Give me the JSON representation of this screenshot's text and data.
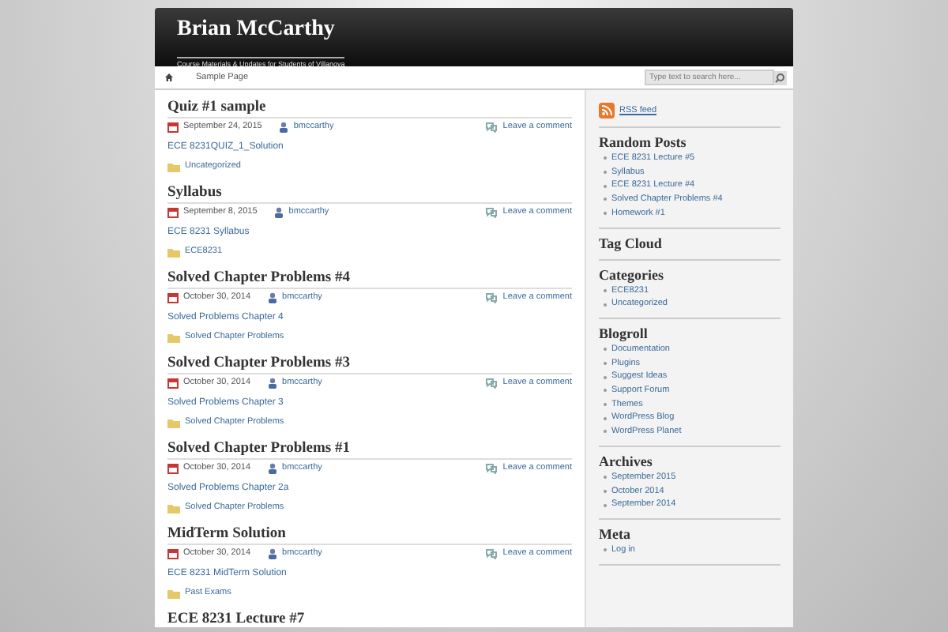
{
  "header": {
    "title": "Brian McCarthy",
    "tagline": "Course Materials & Updates for Students of Villanova"
  },
  "nav": {
    "items": [
      {
        "label": "Sample Page",
        "selected": false
      }
    ],
    "search": {
      "placeholder": "Type text to search here..."
    }
  },
  "posts": [
    {
      "title": "Quiz #1 sample",
      "date": "September 24, 2015",
      "author": "bmccarthy",
      "comments": "Leave a comment",
      "excerpt": "ECE 8231QUIZ_1_Solution",
      "category": "Uncategorized"
    },
    {
      "title": "Syllabus",
      "date": "September 8, 2015",
      "author": "bmccarthy",
      "comments": "Leave a comment",
      "excerpt": "ECE 8231 Syllabus",
      "category": "ECE8231"
    },
    {
      "title": "Solved Chapter Problems #4",
      "date": "October 30, 2014",
      "author": "bmccarthy",
      "comments": "Leave a comment",
      "excerpt": "Solved Problems Chapter 4",
      "category": "Solved Chapter Problems"
    },
    {
      "title": "Solved Chapter Problems #3",
      "date": "October 30, 2014",
      "author": "bmccarthy",
      "comments": "Leave a comment",
      "excerpt": "Solved Problems Chapter 3",
      "category": "Solved Chapter Problems"
    },
    {
      "title": "Solved Chapter Problems #1",
      "date": "October 30, 2014",
      "author": "bmccarthy",
      "comments": "Leave a comment",
      "excerpt": "Solved Problems Chapter 2a",
      "category": "Solved Chapter Problems"
    },
    {
      "title": "MidTerm Solution",
      "date": "October 30, 2014",
      "author": "bmccarthy",
      "comments": "Leave a comment",
      "excerpt": "ECE 8231 MidTerm Solution",
      "category": "Past Exams"
    },
    {
      "title": "ECE 8231 Lecture #7"
    }
  ],
  "sidebar": {
    "rss": "RSS feed",
    "widgets": [
      {
        "title": "Random Posts",
        "items": [
          "ECE 8231 Lecture #5",
          "Syllabus",
          "ECE 8231 Lecture #4",
          "Solved Chapter Problems #4",
          "Homework #1"
        ]
      },
      {
        "title": "Tag Cloud"
      },
      {
        "title": "Categories",
        "items": [
          "ECE8231",
          "Uncategorized"
        ]
      },
      {
        "title": "Blogroll",
        "items": [
          "Documentation",
          "Plugins",
          "Suggest Ideas",
          "Support Forum",
          "Themes",
          "WordPress Blog",
          "WordPress Planet"
        ]
      },
      {
        "title": "Archives",
        "items": [
          "September 2015",
          "October 2014",
          "September 2014"
        ]
      },
      {
        "title": "Meta",
        "items": [
          "Log in"
        ]
      }
    ]
  }
}
